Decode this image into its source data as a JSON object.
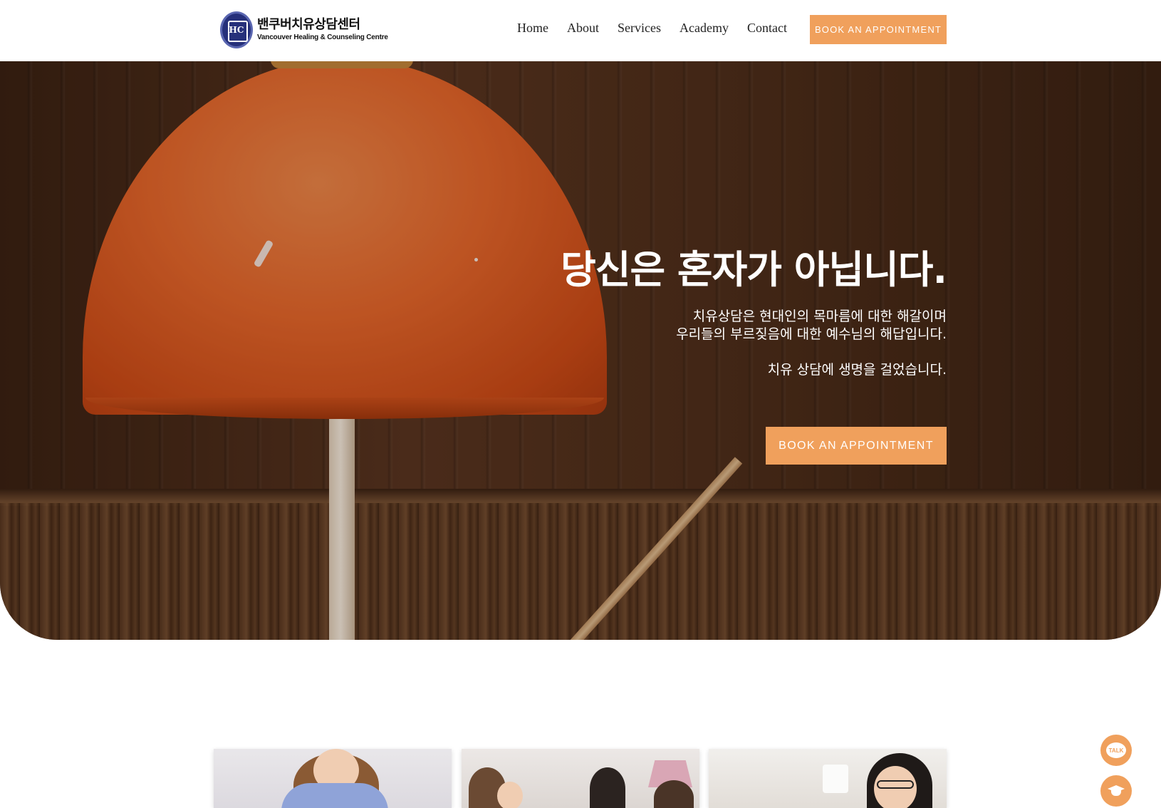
{
  "header": {
    "logo_kr": "밴쿠버치유상담센터",
    "logo_en": "Vancouver Healing & Counseling Centre",
    "logo_emblem_text": "HC",
    "nav": [
      {
        "label": "Home"
      },
      {
        "label": "About"
      },
      {
        "label": "Services"
      },
      {
        "label": "Academy"
      },
      {
        "label": "Contact"
      }
    ],
    "cta_label": "BOOK AN APPOINTMENT"
  },
  "hero": {
    "title": "당신은 혼자가 아닙니다.",
    "subtitle_line1": "치유상담은 현대인의 목마름에 대한 해갈이며",
    "subtitle_line2": "우리들의 부르짖음에 대한 예수님의 해답입니다.",
    "subtitle_line3": "치유 상담에 생명을 걸었습니다.",
    "cta_label": "BOOK AN APPOINTMENT"
  },
  "floating": {
    "talk_label": "TALK",
    "talk_icon": "chat-bubble-icon",
    "academy_icon": "graduation-cap-icon"
  },
  "colors": {
    "accent": "#f0a05c",
    "white": "#ffffff",
    "text": "#222222"
  }
}
